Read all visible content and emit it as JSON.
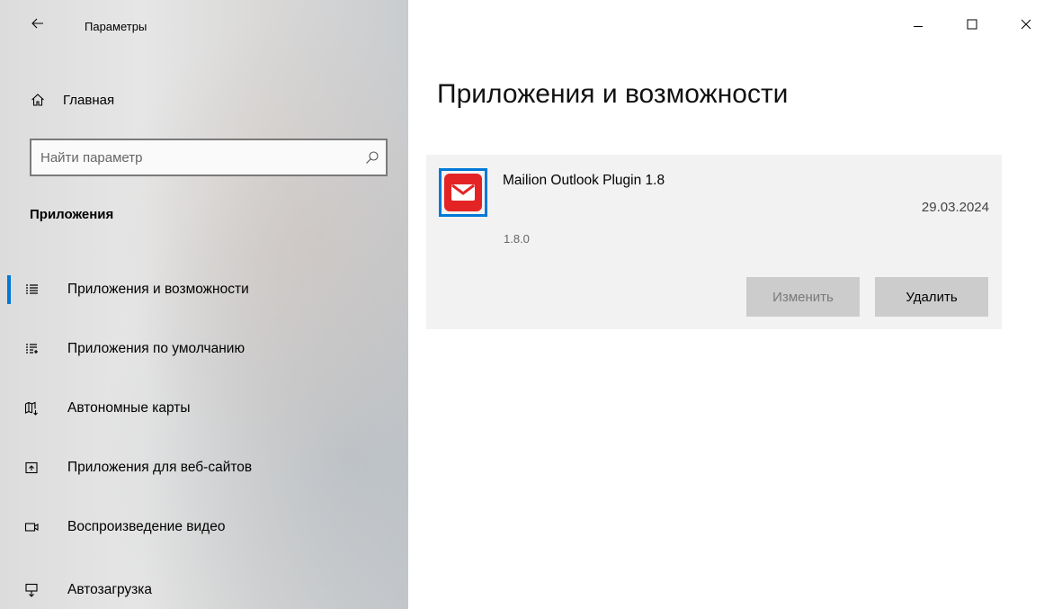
{
  "window": {
    "title": "Параметры",
    "controls": [
      "minimize",
      "maximize",
      "close"
    ]
  },
  "sidebar": {
    "home_label": "Главная",
    "search_placeholder": "Найти параметр",
    "section_title": "Приложения",
    "items": [
      {
        "label": "Приложения и возможности",
        "icon": "apps-features-icon",
        "selected": true
      },
      {
        "label": "Приложения по умолчанию",
        "icon": "default-apps-icon",
        "selected": false
      },
      {
        "label": "Автономные карты",
        "icon": "offline-maps-icon",
        "selected": false
      },
      {
        "label": "Приложения для веб-сайтов",
        "icon": "apps-websites-icon",
        "selected": false
      },
      {
        "label": "Воспроизведение видео",
        "icon": "video-playback-icon",
        "selected": false
      },
      {
        "label": "Автозагрузка",
        "icon": "startup-icon",
        "selected": false
      }
    ]
  },
  "main": {
    "title": "Приложения и возможности",
    "app": {
      "name": "Mailion Outlook Plugin 1.8",
      "date": "29.03.2024",
      "version": "1.8.0",
      "modify_label": "Изменить",
      "uninstall_label": "Удалить"
    }
  },
  "colors": {
    "accent": "#0078d7",
    "app_icon": "#e42424",
    "card_bg": "#f2f2f2",
    "button_bg": "#cccccc"
  }
}
